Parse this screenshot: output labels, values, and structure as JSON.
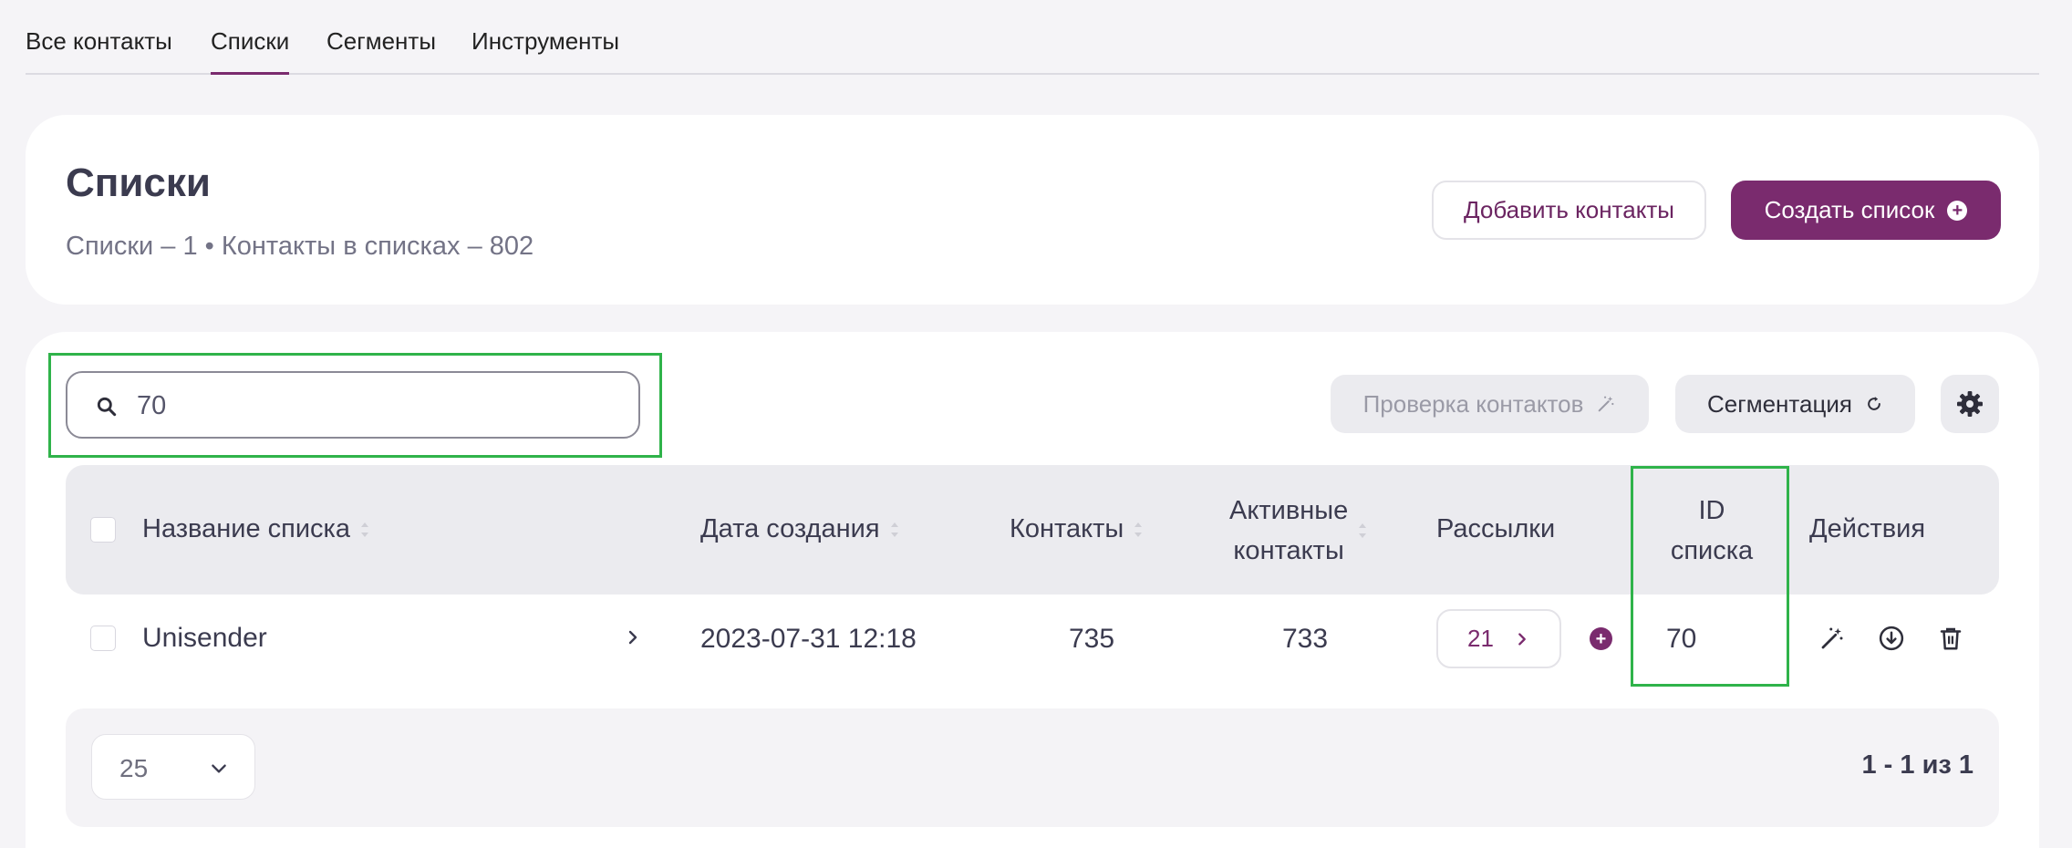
{
  "tabs": [
    {
      "label": "Все контакты",
      "active": false
    },
    {
      "label": "Списки",
      "active": true
    },
    {
      "label": "Сегменты",
      "active": false
    },
    {
      "label": "Инструменты",
      "active": false
    }
  ],
  "header": {
    "title": "Списки",
    "subtitle": "Списки – 1 • Контакты в списках – 802",
    "add_contacts_label": "Добавить контакты",
    "create_list_label": "Создать список"
  },
  "toolbar": {
    "search_value": "70",
    "check_contacts_label": "Проверка контактов",
    "segmentation_label": "Сегментация"
  },
  "table": {
    "columns": {
      "name": "Название списка",
      "created": "Дата создания",
      "contacts": "Контакты",
      "active_line1": "Активные",
      "active_line2": "контакты",
      "mailings": "Рассылки",
      "id_line1": "ID",
      "id_line2": "списка",
      "actions": "Действия"
    },
    "rows": [
      {
        "name": "Unisender",
        "created": "2023-07-31 12:18",
        "contacts": "735",
        "active_contacts": "733",
        "mailings": "21",
        "list_id": "70"
      }
    ]
  },
  "footer": {
    "per_page": "25",
    "pagination": "1 - 1 из 1"
  },
  "colors": {
    "accent": "#7a2b6e",
    "highlight": "#2fb34a"
  }
}
